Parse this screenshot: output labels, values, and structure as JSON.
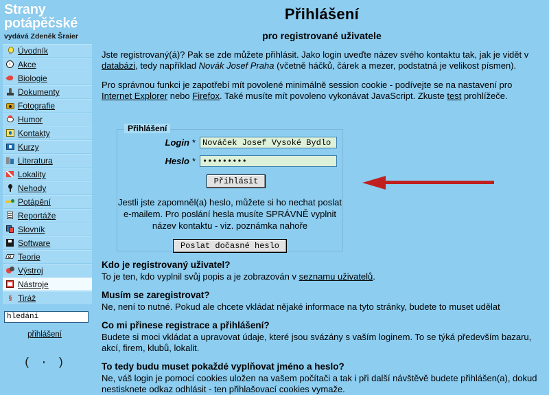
{
  "brand": {
    "line1": "Strany",
    "line2": "potápěčské",
    "publisher": "vydává Zdeněk Šraier"
  },
  "sidebar": {
    "items": [
      {
        "label": "Úvodník",
        "icon": "bulb-icon",
        "active": false
      },
      {
        "label": "Akce",
        "icon": "clock-icon",
        "active": false
      },
      {
        "label": "Biologie",
        "icon": "fish-icon",
        "active": false
      },
      {
        "label": "Dokumenty",
        "icon": "stamp-icon",
        "active": false
      },
      {
        "label": "Fotografie",
        "icon": "camera-icon",
        "active": false
      },
      {
        "label": "Humor",
        "icon": "clown-icon",
        "active": false
      },
      {
        "label": "Kontakty",
        "icon": "contact-icon",
        "active": false
      },
      {
        "label": "Kurzy",
        "icon": "course-icon",
        "active": false
      },
      {
        "label": "Literatura",
        "icon": "book-icon",
        "active": false
      },
      {
        "label": "Lokality",
        "icon": "flag-icon",
        "active": false
      },
      {
        "label": "Nehody",
        "icon": "pin-icon",
        "active": false
      },
      {
        "label": "Potápění",
        "icon": "diver-icon",
        "active": false
      },
      {
        "label": "Reportáže",
        "icon": "report-icon",
        "active": false
      },
      {
        "label": "Slovník",
        "icon": "dictionary-icon",
        "active": false
      },
      {
        "label": "Software",
        "icon": "floppy-disk-icon",
        "active": false
      },
      {
        "label": "Teorie",
        "icon": "theory-icon",
        "active": false
      },
      {
        "label": "Výstroj",
        "icon": "gear-icon",
        "active": false
      },
      {
        "label": "Nástroje",
        "icon": "tools-icon",
        "active": true
      },
      {
        "label": "Tiráž",
        "icon": "paragraph-icon",
        "active": false
      }
    ],
    "search_value": "hledání",
    "login_link": "přihlášení",
    "smiley": "( · )"
  },
  "main": {
    "title": "Přihlášení",
    "subtitle": "pro registrované uživatele",
    "intro1": {
      "part1": "Jste registrovaný(á)? Pak se zde můžete přihlásit. Jako login uveďte název svého kontaktu tak, jak je vidět v ",
      "link1": "databázi",
      "part2": ", tedy například ",
      "italic1": "Novák Josef Praha",
      "part3": " (včetně háčků, čárek a mezer, podstatná je velikost písmen)."
    },
    "intro2": {
      "part1": "Pro správnou funkci je zapotřebí mít povolené minimálně session cookie - podívejte se na nastavení pro ",
      "link1": "Internet Explorer",
      "part2": " nebo ",
      "link2": "Firefox",
      "part3": ". Také musíte mít povoleno vykonávat JavaScript. Zkuste ",
      "link3": "test",
      "part4": " prohlížeče."
    }
  },
  "form": {
    "legend": "Přihlášení",
    "login_label": "Login",
    "login_required": "*",
    "login_value": "Nováček Josef Vysoké Bydlo",
    "password_label": "Heslo",
    "password_required": "*",
    "password_value": "•••••••••",
    "submit_label": "Přihlásit",
    "forgot_text": "Jestli jste zapomněl(a) heslo, můžete si ho nechat poslat e-mailem. Pro poslání hesla musíte SPRÁVNĚ vyplnit název kontaktu - viz. poznámka nahoře",
    "temp_password_label": "Poslat dočasné heslo",
    "arrow_color": "#c0201f"
  },
  "faq": [
    {
      "question": "Kdo je registrovaný uživatel?",
      "answer_part1": "To je ten, kdo vyplnil svůj popis a je zobrazován v ",
      "answer_link": "seznamu uživatelů",
      "answer_part2": "."
    },
    {
      "question": "Musím se zaregistrovat?",
      "answer_part1": "Ne, není to nutné. Pokud ale chcete vkládat nějaké informace na tyto stránky, budete to muset udělat",
      "answer_link": "",
      "answer_part2": ""
    },
    {
      "question": "Co mi přinese registrace a přihlášení?",
      "answer_part1": "Budete si moci vkládat a upravovat údaje, které jsou svázány s vaším loginem. To se týká především bazaru, akcí, firem, klubů, lokalit.",
      "answer_link": "",
      "answer_part2": ""
    },
    {
      "question": "To tedy budu muset pokaždé vyplňovat jméno a heslo?",
      "answer_part1": "Ne, váš login je pomocí cookies uložen na vašem počítači a tak i při další návštěvě budete přihlášen(a), dokud nestisknete odkaz odhlásit - ten přihlašovací cookies vymaže.",
      "answer_link": "",
      "answer_part2": ""
    }
  ],
  "colors": {
    "page_background": "#8ccdf0",
    "menu_item_background": "#a3d9f5",
    "menu_item_active_background": "#f2fbff",
    "input_background": "#ddf0d8",
    "brand_text": "#ffffff"
  }
}
